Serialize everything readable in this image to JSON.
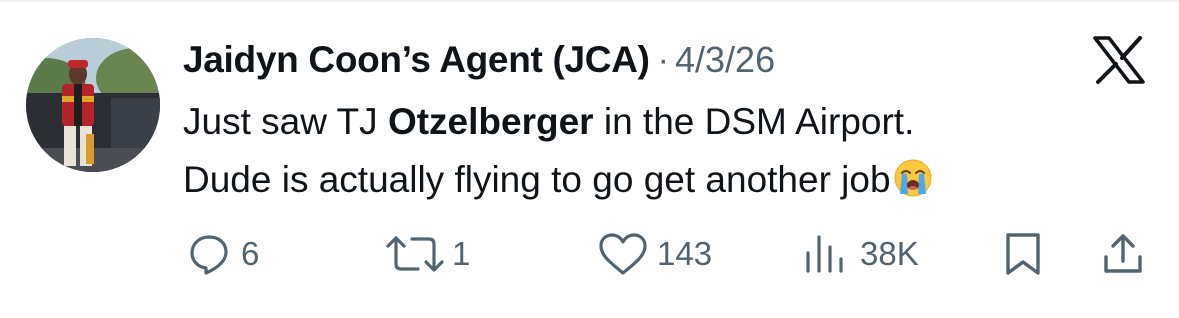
{
  "tweet": {
    "display_name": "Jaidyn Coon’s Agent (JCA)",
    "separator": "·",
    "date": "4/3/26",
    "line1_prefix": "Just saw TJ ",
    "line1_bold": "Otzelberger",
    "line1_suffix": " in the DSM Airport.",
    "line2": "Dude is actually flying to go get another job",
    "emoji": "loudly-crying-face-emoji"
  },
  "actions": {
    "replies": "6",
    "reposts": "1",
    "likes": "143",
    "views": "38K"
  },
  "icons": {
    "logo": "x-logo-icon",
    "reply": "reply-icon",
    "repost": "repost-icon",
    "like": "heart-icon",
    "views": "views-icon",
    "bookmark": "bookmark-icon",
    "share": "share-icon"
  },
  "colors": {
    "text": "#0f1419",
    "secondary": "#536471",
    "divider": "#eff3f4"
  }
}
